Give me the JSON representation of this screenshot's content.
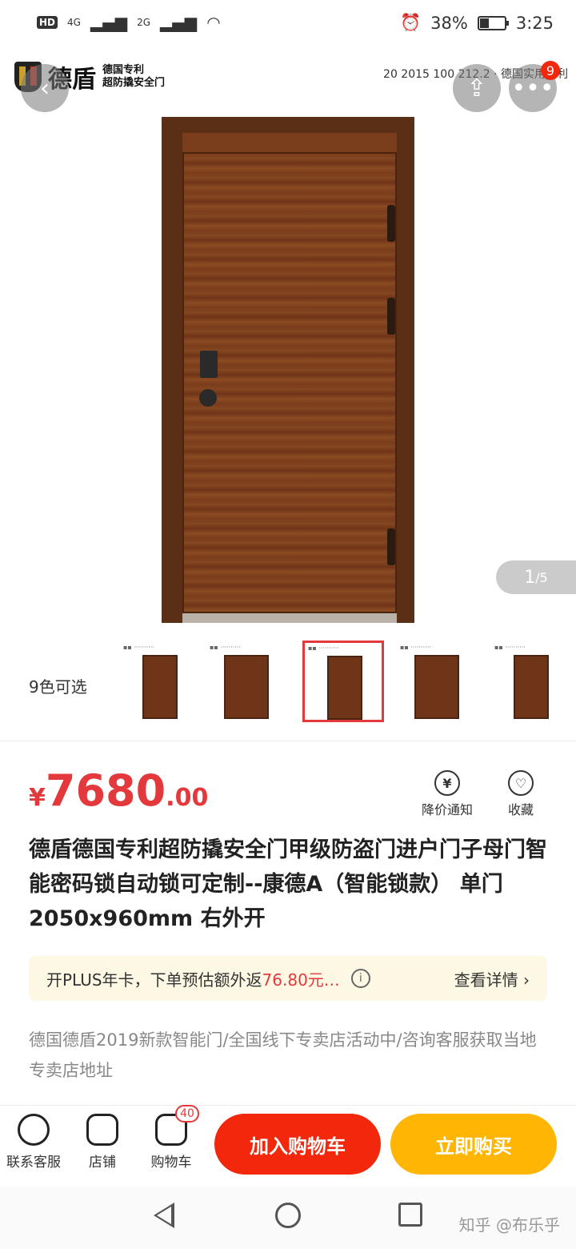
{
  "status": {
    "hd": "HD",
    "net1": "4G",
    "net2": "2G",
    "battery_pct": "38%",
    "battery_level": 0.38,
    "time": "3:25"
  },
  "hero": {
    "brand_name": "德盾",
    "brand_sub1": "德国专利",
    "brand_sub2": "超防撬安全门",
    "patent_text": "20 2015 100 212.2 · 德国实用专利",
    "more_badge": "9",
    "pager_current": "1",
    "pager_total": "/5"
  },
  "colors": {
    "label": "9色可选",
    "selected_index": 2
  },
  "price": {
    "symbol": "¥",
    "integer": "7680",
    "decimal": ".00"
  },
  "actions": {
    "notify": "降价通知",
    "notify_icon": "¥",
    "favorite": "收藏",
    "favorite_icon": "♡"
  },
  "product": {
    "title": "德盾德国专利超防撬安全门甲级防盗门进户门子母门智能密码锁自动锁可定制--康德A（智能锁款） 单门2050x960mm 右外开"
  },
  "plus": {
    "text_before": "开PLUS年卡，下单预估额外返",
    "amount": "76.80元…",
    "info_icon": "i",
    "detail": "查看详情 ›"
  },
  "promo": {
    "text": "德国德盾2019新款智能门/全国线下专卖店活动中/咨询客服获取当地专卖店地址"
  },
  "bottom": {
    "service": "联系客服",
    "store": "店铺",
    "cart": "购物车",
    "cart_count": "40",
    "add_to_cart": "加入购物车",
    "buy_now": "立即购买"
  },
  "watermark": "知乎 @布乐乎",
  "theme": {
    "accent_red": "#e4393c",
    "cart_red": "#f2270c",
    "buy_yellow": "#ffb503"
  }
}
